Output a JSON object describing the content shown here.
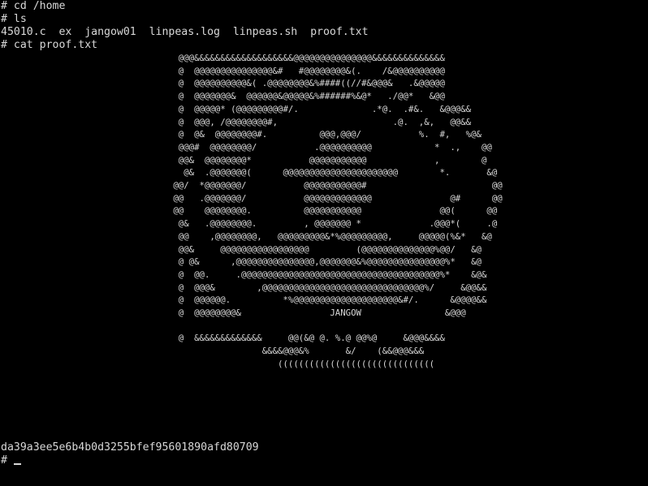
{
  "terminal": {
    "background": "#000000",
    "foreground": "#d8d8d8",
    "lines": [
      "# cd /home",
      "# ls",
      "45010.c  ex  jangow01  linpeas.log  linpeas.sh  proof.txt",
      "# cat proof.txt"
    ],
    "proof_art": [
      "                                  @@@&&&&&&&&&&&&&&&&&&&@@@@@@@@@@@@@@@&&&&&&&&&&&&&&",
      "                                  @  @@@@@@@@@@@@@@@&#   #@@@@@@@@&(.    /&@@@@@@@@@@",
      "                                  @  @@@@@@@@@@&( .@@@@@@@@&%####((//#&@@@&   .&@@@@@",
      "                                  @  @@@@@@@&  @@@@@@&@@@@@&%######%&@*   ./@@*   &@@",
      "                                  @  @@@@@* (@@@@@@@@@#/.              .*@.  .#&.   &@@@&&",
      "                                  @  @@@, /@@@@@@@@#,                      .@.  ,&,   @@&&",
      "                                  @  @&  @@@@@@@@#.          @@@,@@@/           %.  #,   %@&",
      "                                  @@@#  @@@@@@@@/           .@@@@@@@@@@            *  .,    @@",
      "                                  @@&  @@@@@@@@*           @@@@@@@@@@@             ,        @",
      "                                   @&  .@@@@@@@(      @@@@@@@@@@@@@@@@@@@@@@        *.       &@",
      "                                 @@/  *@@@@@@@/           @@@@@@@@@@@#                        @@",
      "                                 @@   .@@@@@@@/           @@@@@@@@@@@@@               @#      @@",
      "                                 @@    @@@@@@@@.          @@@@@@@@@@@               @@(      @@",
      "                                  @&   .@@@@@@@@.         , @@@@@@@ *             .@@@*(     .@",
      "                                  @@    ,@@@@@@@@,   @@@@@@@@@&*%@@@@@@@@@,     @@@@@(%&*   &@",
      "                                  @@&     @@@@@@@@@@@@@@@@@         (@@@@@@@@@@@@@@%@@/   &@",
      "                                  @ @&      ,@@@@@@@@@@@@@@@,@@@@@@@&%@@@@@@@@@@@@@@@%*   &@",
      "                                  @  @@.     .@@@@@@@@@@@@@@@@@@@@@@@@@@@@@@@@@@@@@@%*    &@&",
      "                                  @  @@@&        ,@@@@@@@@@@@@@@@@@@@@@@@@@@@@@@@%/     &@@&&",
      "                                  @  @@@@@@.          *%@@@@@@@@@@@@@@@@@@@@&#/.      &@@@@&&",
      "                                  @  @@@@@@@@&                 JANGOW                &@@@",
      "",
      "                                  @  &&&&&&&&&&&&&     @@(&@ @. %.@ @@%@     &@@@&&&&",
      "                                                  &&&&@@@&%       &/    (&&@@@&&&",
      "                                                     (((((((((((((((((((((((((((((("
    ],
    "hash": "da39a3ee5e6b4b0d3255bfef95601890afd80709",
    "prompt": "# "
  }
}
